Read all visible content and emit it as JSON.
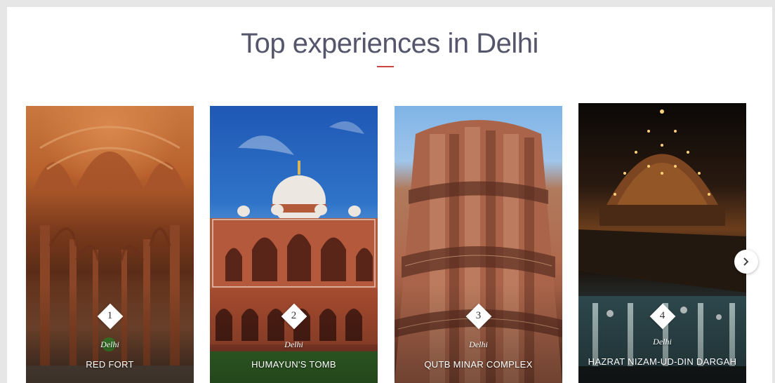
{
  "heading": {
    "title": "Top experiences in Delhi"
  },
  "experiences": [
    {
      "rank": "1",
      "city": "Delhi",
      "title": "RED FORT"
    },
    {
      "rank": "2",
      "city": "Delhi",
      "title": "HUMAYUN'S TOMB"
    },
    {
      "rank": "3",
      "city": "Delhi",
      "title": "QUTB MINAR COMPLEX"
    },
    {
      "rank": "4",
      "city": "Delhi",
      "title": "HAZRAT NIZAM-UD-DIN DARGAH"
    }
  ],
  "navigation": {
    "next_icon": "chevron-right-icon"
  },
  "colors": {
    "accent": "#c9443f",
    "heading_text": "#55566b",
    "page_background": "#e6e6e6",
    "panel_background": "#ffffff"
  }
}
